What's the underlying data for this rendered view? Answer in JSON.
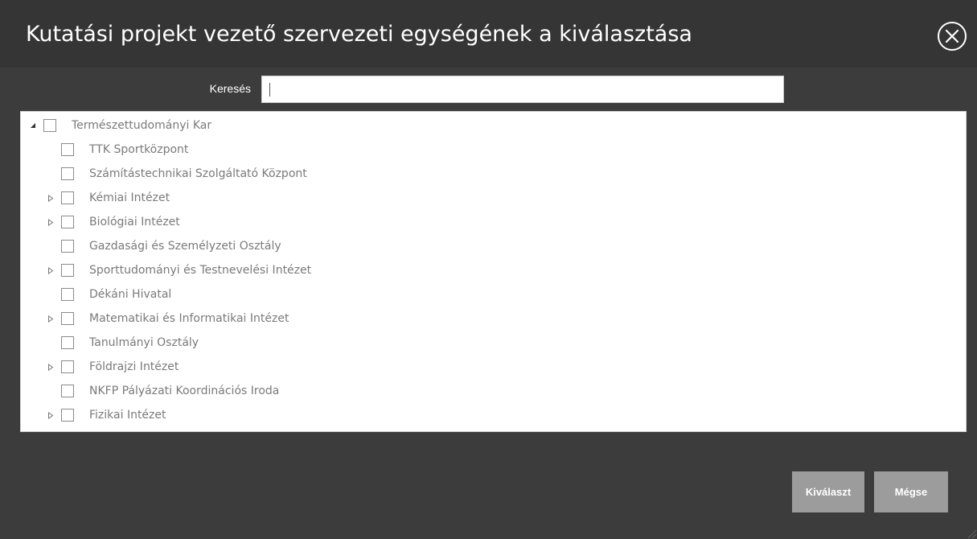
{
  "dialog": {
    "title": "Kutatási projekt vezető szervezeti egységének a kiválasztása",
    "close_icon": "close-circle-icon"
  },
  "search": {
    "label": "Keresés",
    "value": ""
  },
  "tree": {
    "root": {
      "label": "Természettudományi Kar",
      "expanded": true,
      "checked": false
    },
    "children": [
      {
        "label": "TTK Sportközpont",
        "has_children": false,
        "checked": false
      },
      {
        "label": "Számítástechnikai Szolgáltató Központ",
        "has_children": false,
        "checked": false
      },
      {
        "label": "Kémiai Intézet",
        "has_children": true,
        "checked": false
      },
      {
        "label": "Biológiai Intézet",
        "has_children": true,
        "checked": false
      },
      {
        "label": "Gazdasági és Személyzeti Osztály",
        "has_children": false,
        "checked": false
      },
      {
        "label": "Sporttudományi és Testnevelési Intézet",
        "has_children": true,
        "checked": false
      },
      {
        "label": "Dékáni Hivatal",
        "has_children": false,
        "checked": false
      },
      {
        "label": "Matematikai és Informatikai Intézet",
        "has_children": true,
        "checked": false
      },
      {
        "label": "Tanulmányi Osztály",
        "has_children": false,
        "checked": false
      },
      {
        "label": "Földrajzi Intézet",
        "has_children": true,
        "checked": false
      },
      {
        "label": "NKFP Pályázati Koordinációs Iroda",
        "has_children": false,
        "checked": false
      },
      {
        "label": "Fizikai Intézet",
        "has_children": true,
        "checked": false
      }
    ]
  },
  "buttons": {
    "select_label": "Kiválaszt",
    "cancel_label": "Mégse"
  },
  "colors": {
    "header_bg": "#353535",
    "body_bg": "#3c3c3c",
    "button_bg": "#9c9c9c",
    "tree_text": "#7a7a7a"
  }
}
